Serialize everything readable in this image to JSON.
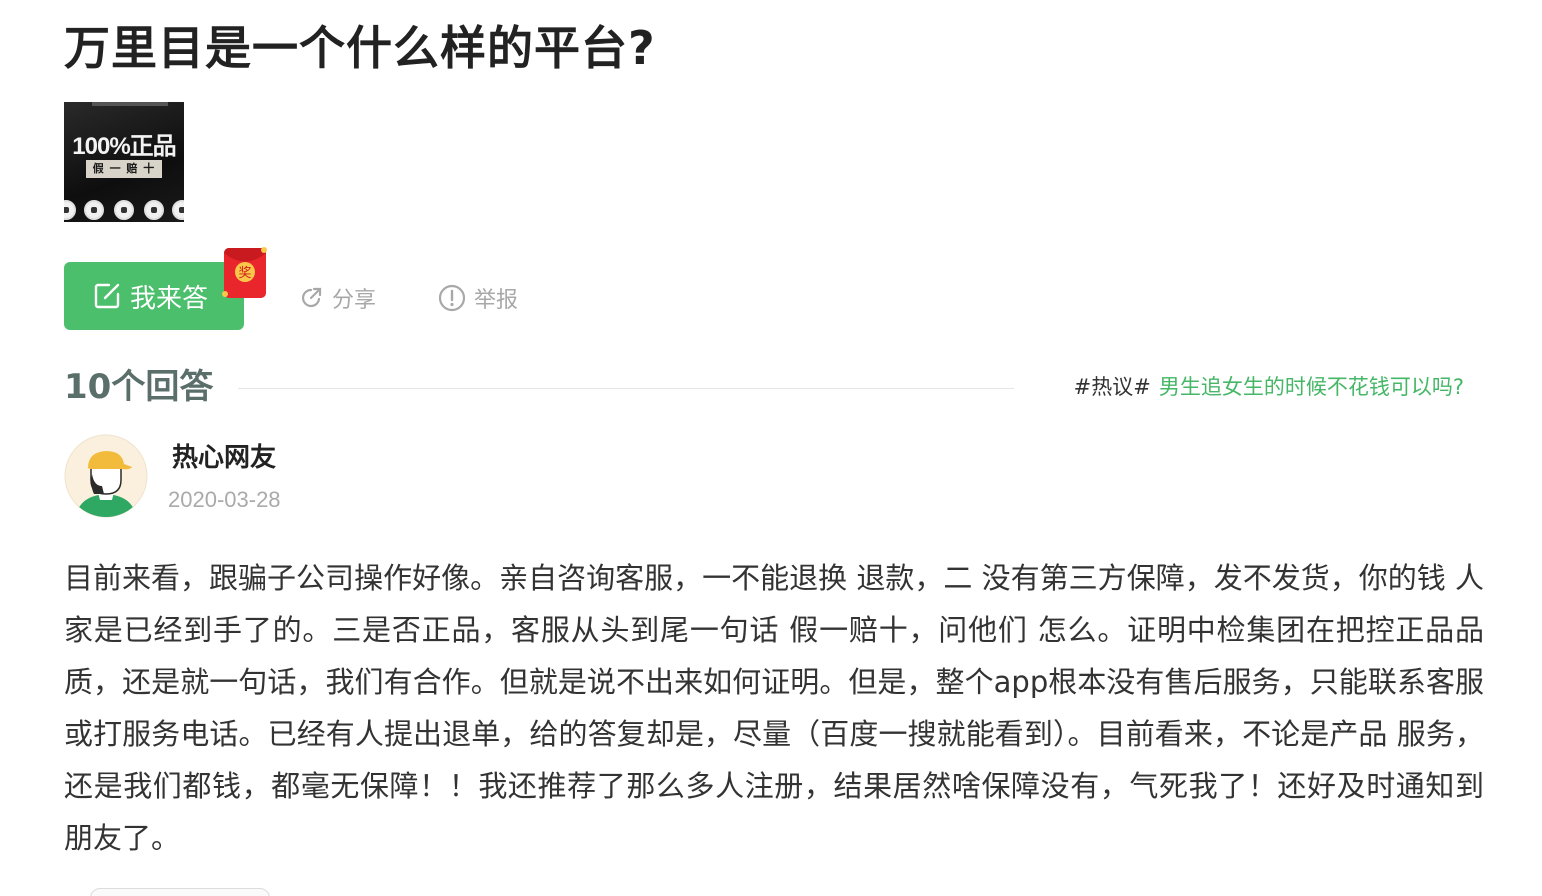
{
  "question": {
    "title": "万里目是一个什么样的平台?",
    "thumbnail": {
      "headline": "100%正品",
      "tagline": "假 一 赔 十"
    }
  },
  "actions": {
    "answer_label": "我来答",
    "answer_badge": "奖",
    "share_label": "分享",
    "report_label": "举报"
  },
  "answers_header": {
    "count_label": "10个回答",
    "hot_tag": "#热议#",
    "hot_link": "男生追女生的时候不花钱可以吗?"
  },
  "answer": {
    "user_name": "热心网友",
    "date": "2020-03-28",
    "body": "目前来看，跟骗子公司操作好像。亲自咨询客服，一不能退换 退款，二 没有第三方保障，发不发货，你的钱 人家是已经到手了的。三是否正品，客服从头到尾一句话 假一赔十，问他们 怎么。证明中检集团在把控正品品质，还是就一句话，我们有合作。但就是说不出来如何证明。但是，整个app根本没有售后服务，只能联系客服或打服务电话。已经有人提出退单，给的答复却是，尽量（百度一搜就能看到）。目前看来，不论是产品 服务，还是我们都钱，都毫无保障！！我还推荐了那么多人注册，结果居然啥保障没有，气死我了！还好及时通知到朋友了。"
  },
  "colors": {
    "primary_green": "#4bbf6b",
    "link_green": "#46b767",
    "muted_gray": "#a8a8a8"
  },
  "icons": {
    "answer": "edit-icon",
    "share": "share-icon",
    "report": "report-icon",
    "badge": "red-packet-icon"
  }
}
